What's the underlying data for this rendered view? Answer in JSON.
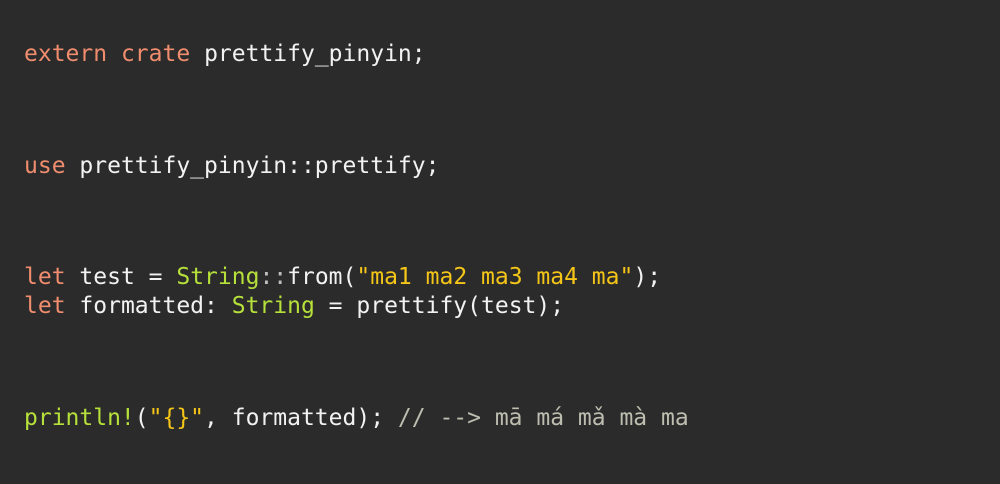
{
  "colors": {
    "background": "#2b2b2b",
    "keyword": "#f08d6e",
    "type": "#b6e03a",
    "string": "#f5c518",
    "comment": "#bdbdb0",
    "text": "#f2f2f2"
  },
  "code": {
    "line1": {
      "kw1": "extern",
      "kw2": "crate",
      "rest": "prettify_pinyin;"
    },
    "line2": {
      "kw": "use",
      "rest": "prettify_pinyin::prettify;"
    },
    "line3": {
      "kw": "let",
      "pre": "test = ",
      "type": "String",
      "sep": "::",
      "call": "from(",
      "str": "\"ma1 ma2 ma3 ma4 ma\"",
      "end": ");"
    },
    "line4": {
      "kw": "let",
      "pre": "formatted: ",
      "type": "String",
      "rest": " = prettify(test);"
    },
    "line5": {
      "macro": "println!",
      "open": "(",
      "str": "\"{}\"",
      "mid": ", formatted); ",
      "comment": "// --> mā má mǎ mà ma"
    }
  }
}
